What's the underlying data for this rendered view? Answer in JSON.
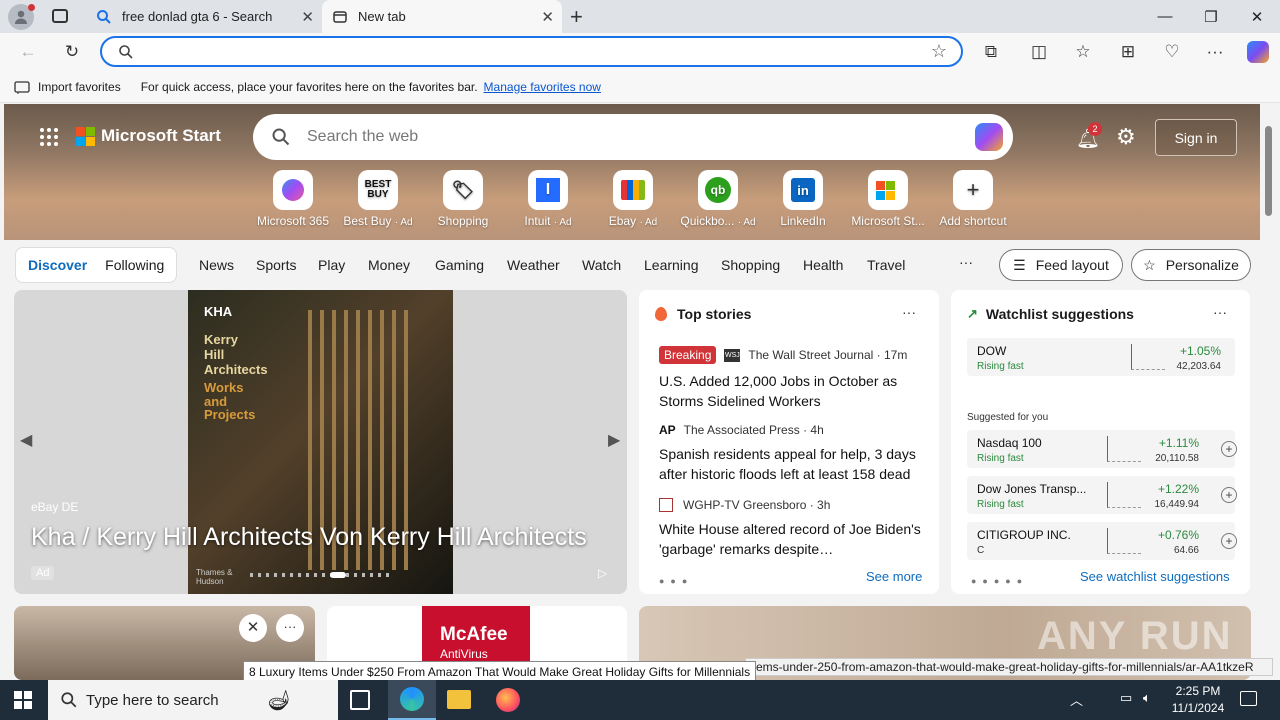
{
  "tabs": [
    {
      "title": "free donlad gta 6 - Search"
    },
    {
      "title": "New tab"
    }
  ],
  "favorites_bar": {
    "import_label": "Import favorites",
    "hint": "For quick access, place your favorites here on the favorites bar.",
    "manage_link": "Manage favorites now"
  },
  "header": {
    "brand": "Microsoft Start",
    "search_placeholder": "Search the web",
    "notification_count": "2",
    "signin_label": "Sign in"
  },
  "quick_links": [
    {
      "label": "Microsoft 365",
      "ad": ""
    },
    {
      "label": "Best Buy",
      "ad": "· Ad"
    },
    {
      "label": "Shopping",
      "ad": ""
    },
    {
      "label": "Intuit",
      "ad": "· Ad"
    },
    {
      "label": "Ebay",
      "ad": "· Ad"
    },
    {
      "label": "Quickbo...",
      "ad": "· Ad"
    },
    {
      "label": "LinkedIn",
      "ad": ""
    },
    {
      "label": "Microsoft St...",
      "ad": ""
    },
    {
      "label": "Add shortcut",
      "ad": ""
    }
  ],
  "feed_nav": {
    "discover": "Discover",
    "following": "Following",
    "items": [
      "News",
      "Sports",
      "Play",
      "Money",
      "Gaming",
      "Weather",
      "Watch",
      "Learning",
      "Shopping",
      "Health",
      "Travel"
    ],
    "more": "···",
    "feed_layout": "Feed layout",
    "personalize": "Personalize"
  },
  "carousel": {
    "source": "eBay DE",
    "title": "Kha / Kerry Hill Architects Von Kerry Hill Architects",
    "ad_label": "Ad",
    "book_lines": [
      "KHA",
      "Kerry",
      "Hill",
      "Architects",
      "Works",
      "and",
      "Projects"
    ],
    "book_footer": "Thames & Hudson"
  },
  "top_stories": {
    "title": "Top stories",
    "stories": [
      {
        "badge": "Breaking",
        "source": "The Wall Street Journal · 17m",
        "headline": "U.S. Added 12,000 Jobs in October as Storms Sidelined Workers"
      },
      {
        "badge": "",
        "source": "The Associated Press · 4h",
        "headline": "Spanish residents appeal for help, 3 days after historic floods left at least 158 dead"
      },
      {
        "badge": "",
        "source": "WGHP-TV Greensboro · 3h",
        "headline": "White House altered record of Joe Biden's 'garbage' remarks despite…"
      }
    ],
    "see_more": "See more"
  },
  "watchlist": {
    "title": "Watchlist suggestions",
    "top": {
      "name": "DOW",
      "status": "Rising fast",
      "pct": "+1.05%",
      "value": "42,203.64"
    },
    "suggested_label": "Suggested for you",
    "items": [
      {
        "name": "Nasdaq 100",
        "status": "Rising fast",
        "pct": "+1.11%",
        "value": "20,110.58"
      },
      {
        "name": "Dow Jones Transp...",
        "status": "Rising fast",
        "pct": "+1.22%",
        "value": "16,449.94"
      },
      {
        "name": "CITIGROUP INC.",
        "status": "C",
        "pct": "+0.76%",
        "value": "64.66"
      }
    ],
    "see_link": "See watchlist suggestions"
  },
  "bottom_cards": {
    "mcafee_brand": "McAfee",
    "mcafee_sub": "AntiVirus"
  },
  "tooltip": "8 Luxury Items Under $250 From Amazon That Would Make Great Holiday Gifts for Millennials",
  "status_url": "items-under-250-from-amazon-that-would-make-great-holiday-gifts-for-millennials/ar-AA1tkzeR",
  "watermark": "ANY RUN",
  "taskbar": {
    "search_placeholder": "Type here to search",
    "time": "2:25 PM",
    "date": "11/1/2024"
  },
  "colors": {
    "accent": "#1a73e8",
    "discover": "#0f6cbd",
    "positive": "#2b8a3e",
    "breaking": "#d13438"
  }
}
